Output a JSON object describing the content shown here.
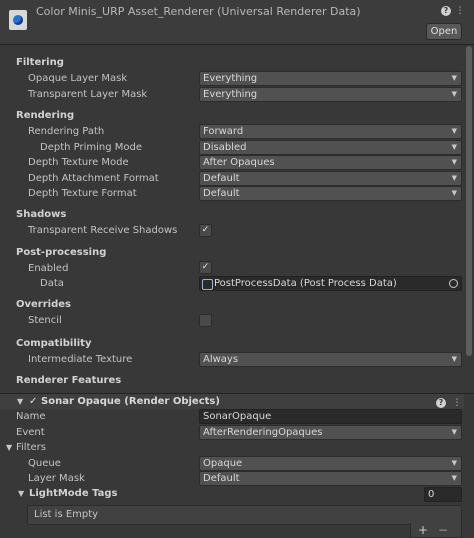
{
  "header": {
    "title": "Color Minis_URP Asset_Renderer (Universal Renderer Data)",
    "open_label": "Open"
  },
  "filtering": {
    "title": "Filtering",
    "opaque_label": "Opaque Layer Mask",
    "opaque_value": "Everything",
    "transparent_label": "Transparent Layer Mask",
    "transparent_value": "Everything"
  },
  "rendering": {
    "title": "Rendering",
    "path_label": "Rendering Path",
    "path_value": "Forward",
    "priming_label": "Depth Priming Mode",
    "priming_value": "Disabled",
    "depth_tex_label": "Depth Texture Mode",
    "depth_tex_value": "After Opaques",
    "attach_label": "Depth Attachment Format",
    "attach_value": "Default",
    "format_label": "Depth Texture Format",
    "format_value": "Default"
  },
  "shadows": {
    "title": "Shadows",
    "trs_label": "Transparent Receive Shadows",
    "trs_checked": true
  },
  "post": {
    "title": "Post-processing",
    "enabled_label": "Enabled",
    "enabled_checked": true,
    "data_label": "Data",
    "data_value": "PostProcessData (Post Process Data)"
  },
  "overrides": {
    "title": "Overrides",
    "stencil_label": "Stencil",
    "stencil_checked": false
  },
  "compat": {
    "title": "Compatibility",
    "inter_label": "Intermediate Texture",
    "inter_value": "Always"
  },
  "features": {
    "title": "Renderer Features",
    "item": {
      "title": "Sonar Opaque (Render Objects)",
      "name_label": "Name",
      "name_value": "SonarOpaque",
      "event_label": "Event",
      "event_value": "AfterRenderingOpaques",
      "filters_label": "Filters",
      "queue_label": "Queue",
      "queue_value": "Opaque",
      "layer_label": "Layer Mask",
      "layer_value": "Default",
      "lightmode_label": "LightMode Tags",
      "lightmode_count": "0",
      "empty_label": "List is Empty"
    }
  },
  "icons": {
    "help": "?",
    "menu": "⋮",
    "check": "✓",
    "dropdown": "▼",
    "plus": "+",
    "minus": "−"
  }
}
